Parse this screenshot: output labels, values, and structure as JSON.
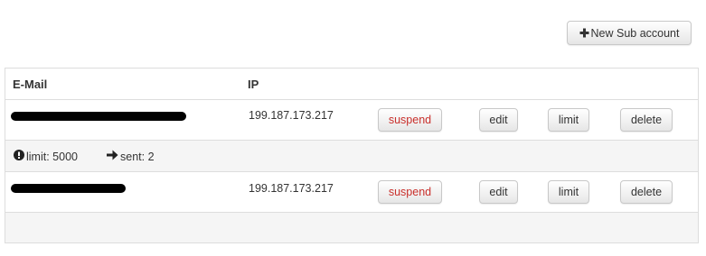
{
  "toolbar": {
    "new_sub_account_label": "New Sub account",
    "new_sub_account_icon": "plus-icon"
  },
  "table": {
    "columns": [
      "E-Mail",
      "IP"
    ],
    "rows": [
      {
        "email": "redacted",
        "ip": "199.187.173.217",
        "actions": [
          "suspend",
          "edit",
          "limit",
          "delete"
        ]
      },
      {
        "email": "redacted",
        "ip": "199.187.173.217",
        "actions": [
          "suspend",
          "edit",
          "limit",
          "delete"
        ]
      }
    ],
    "info": {
      "limit_icon": "exclamation-circle-icon",
      "limit_text": "limit: 5000",
      "sent_icon": "arrow-right-icon",
      "sent_text": "sent: 2"
    }
  },
  "colors": {
    "suspend_text": "#c9302c",
    "row_alt_bg": "#f5f5f5",
    "border": "#dddddd"
  }
}
